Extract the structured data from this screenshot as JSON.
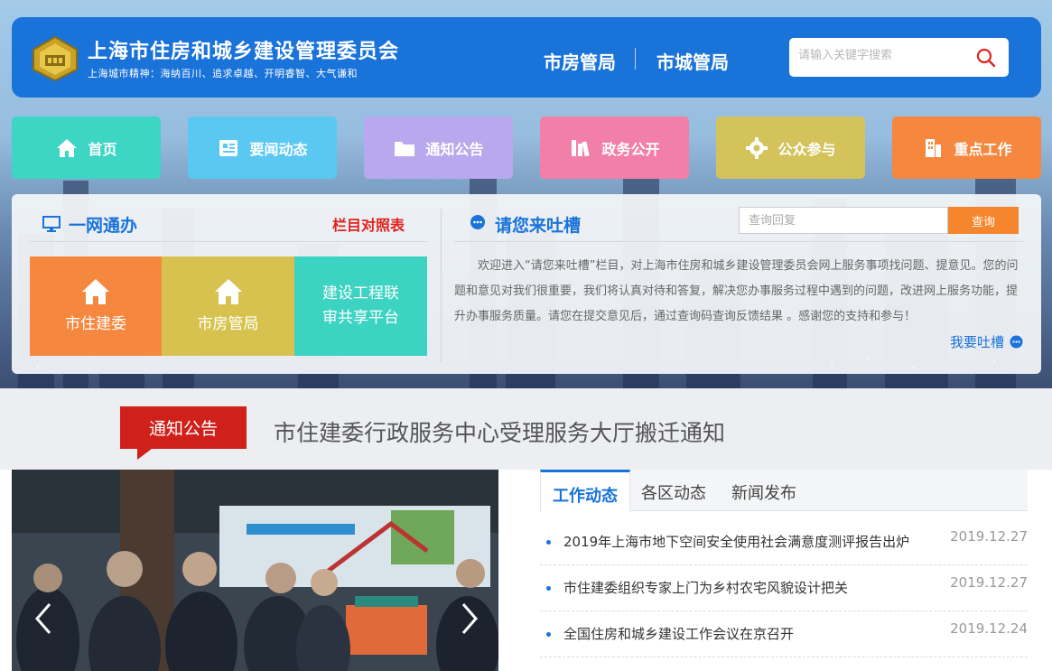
{
  "header": {
    "title": "上海市住房和城乡建设管理委员会",
    "subtitle": "上海城市精神：海纳百川、追求卓越、开明睿智、大气谦和",
    "links": [
      "市房管局",
      "市城管局"
    ],
    "search_placeholder": "请输入关键字搜索",
    "color": "#1a73d9"
  },
  "nav": [
    {
      "label": "首页",
      "icon": "home-icon",
      "color": "#3dd6c4"
    },
    {
      "label": "要闻动态",
      "icon": "news-icon",
      "color": "#5ac8f0"
    },
    {
      "label": "通知公告",
      "icon": "folder-icon",
      "color": "#b9a8ee"
    },
    {
      "label": "政务公开",
      "icon": "books-icon",
      "color": "#f27fa8"
    },
    {
      "label": "公众参与",
      "icon": "gear-icon",
      "color": "#d4c25a"
    },
    {
      "label": "重点工作",
      "icon": "building-icon",
      "color": "#f5873f"
    }
  ],
  "one_net": {
    "title": "一网通办",
    "compare_link": "栏目对照表",
    "services": [
      {
        "label": "市住建委",
        "color": "#f5873f"
      },
      {
        "label": "市房管局",
        "color": "#d8c24f"
      },
      {
        "label": "建设工程联审共享平台",
        "color": "#3dd3c2"
      }
    ]
  },
  "tucao": {
    "title": "请您来吐槽",
    "query_placeholder": "查询回复",
    "query_button": "查询",
    "intro": "欢迎进入“请您来吐槽”栏目，对上海市住房和城乡建设管理委员会网上服务事项找问题、提意见。您的问题和意见对我们很重要，我们将认真对待和答复，解决您办事服务过程中遇到的问题，改进网上服务功能，提升办事服务质量。请您在提交意见后，通过查询码查询反馈结果 。感谢您的支持和参与！",
    "link": "我要吐槽"
  },
  "notice": {
    "tag": "通知公告",
    "headline": "市住建委行政服务中心受理服务大厅搬迁通知"
  },
  "news": {
    "tabs": [
      "工作动态",
      "各区动态",
      "新闻发布"
    ],
    "items": [
      {
        "title": "2019年上海市地下空间安全使用社会满意度测评报告出炉",
        "date": "2019.12.27"
      },
      {
        "title": "市住建委组织专家上门为乡村农宅风貌设计把关",
        "date": "2019.12.27"
      },
      {
        "title": "全国住房和城乡建设工作会议在京召开",
        "date": "2019.12.24"
      }
    ]
  }
}
